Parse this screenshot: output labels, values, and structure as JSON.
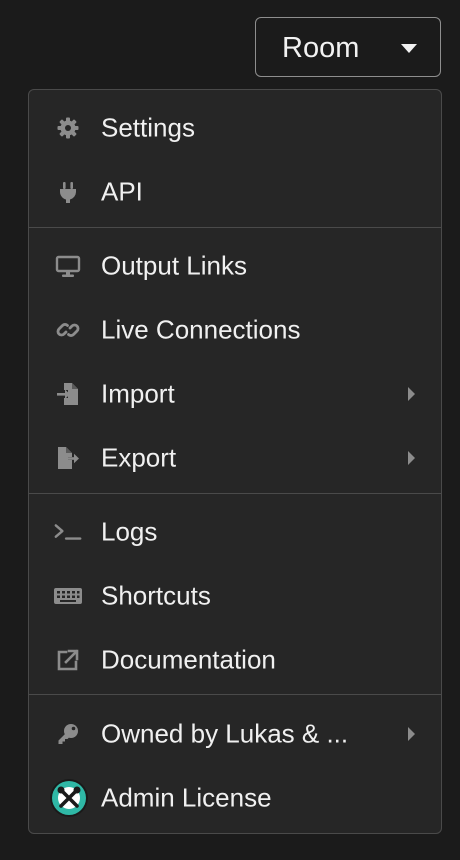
{
  "header": {
    "room_label": "Room"
  },
  "menu": {
    "items": [
      {
        "label": "Settings",
        "icon": "gear-icon"
      },
      {
        "label": "API",
        "icon": "plug-icon"
      },
      {
        "label": "Output Links",
        "icon": "monitor-icon"
      },
      {
        "label": "Live Connections",
        "icon": "link-icon"
      },
      {
        "label": "Import",
        "icon": "file-import-icon",
        "submenu": true
      },
      {
        "label": "Export",
        "icon": "file-export-icon",
        "submenu": true
      },
      {
        "label": "Logs",
        "icon": "terminal-icon"
      },
      {
        "label": "Shortcuts",
        "icon": "keyboard-icon"
      },
      {
        "label": "Documentation",
        "icon": "external-link-icon"
      },
      {
        "label": "Owned by Lukas & ...",
        "icon": "key-icon",
        "submenu": true
      },
      {
        "label": "Admin License",
        "icon": "admin-avatar-icon"
      }
    ]
  },
  "colors": {
    "background": "#1b1b1b",
    "menu_background": "#262626",
    "icon_gray": "#8c8c8c",
    "avatar_teal": "#2fb8a6"
  }
}
